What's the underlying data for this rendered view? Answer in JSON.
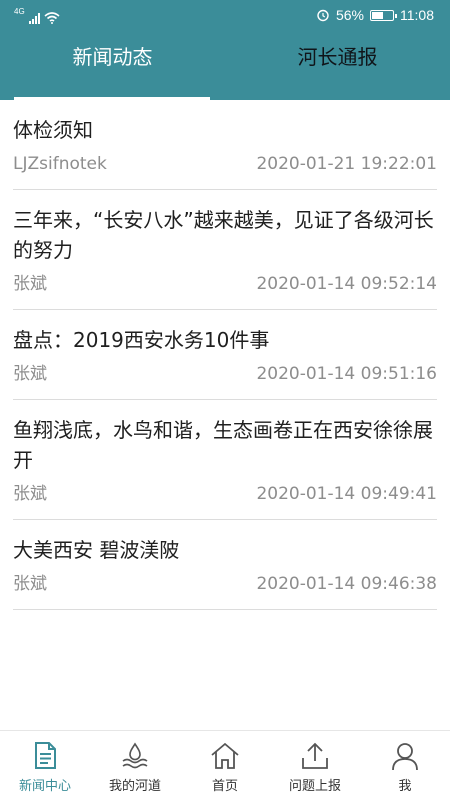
{
  "status_bar": {
    "network": "4G",
    "battery": "56%",
    "battery_level": 0.56,
    "time": "11:08"
  },
  "tabs": [
    {
      "label": "新闻动态",
      "active": true
    },
    {
      "label": "河长通报",
      "active": false
    }
  ],
  "news": [
    {
      "title": "体检须知",
      "author": "LJZsifnotek",
      "datetime": "2020-01-21 19:22:01"
    },
    {
      "title": "三年来，“长安八水”越来越美，见证了各级河长的努力",
      "author": "张斌",
      "datetime": "2020-01-14 09:52:14"
    },
    {
      "title": "盘点：2019西安水务10件事",
      "author": "张斌",
      "datetime": "2020-01-14 09:51:16"
    },
    {
      "title": "鱼翔浅底，水鸟和谐，生态画卷正在西安徐徐展开",
      "author": "张斌",
      "datetime": "2020-01-14 09:49:41"
    },
    {
      "title": "大美西安 碧波渼陂",
      "author": "张斌",
      "datetime": "2020-01-14 09:46:38"
    }
  ],
  "bottom_nav": [
    {
      "label": "新闻中心",
      "icon": "document-icon",
      "active": true
    },
    {
      "label": "我的河道",
      "icon": "water-icon",
      "active": false
    },
    {
      "label": "首页",
      "icon": "home-icon",
      "active": false
    },
    {
      "label": "问题上报",
      "icon": "upload-icon",
      "active": false
    },
    {
      "label": "我",
      "icon": "person-icon",
      "active": false
    }
  ],
  "colors": {
    "primary": "#3b8d99",
    "divider": "#dcdcdc",
    "meta_text": "#8d8d8d"
  }
}
